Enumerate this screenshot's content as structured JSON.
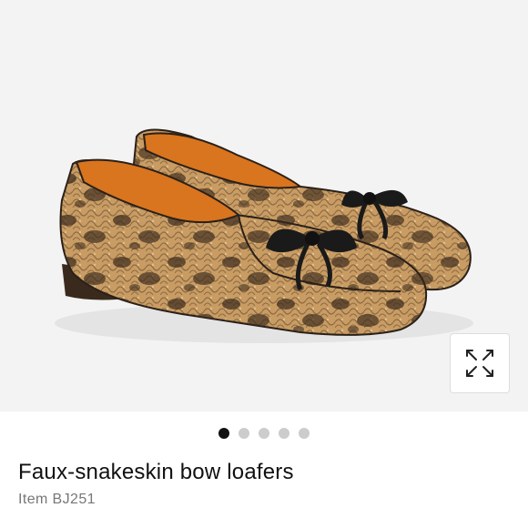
{
  "product": {
    "title": "Faux-snakeskin bow loafers",
    "item_number": "Item BJ251",
    "image_alt": "Faux-snakeskin bow loafers pair"
  },
  "gallery": {
    "slide_count": 5,
    "active_index": 0,
    "expand_icon": "expand-arrows-icon"
  },
  "colors": {
    "image_bg": "#f3f3f3",
    "snake_base": "#c79a62",
    "snake_dark": "#3b2b1d",
    "lining": "#d9741f",
    "bow": "#1a1a1a",
    "dot_active": "#111111",
    "dot_inactive": "#cccccc"
  }
}
